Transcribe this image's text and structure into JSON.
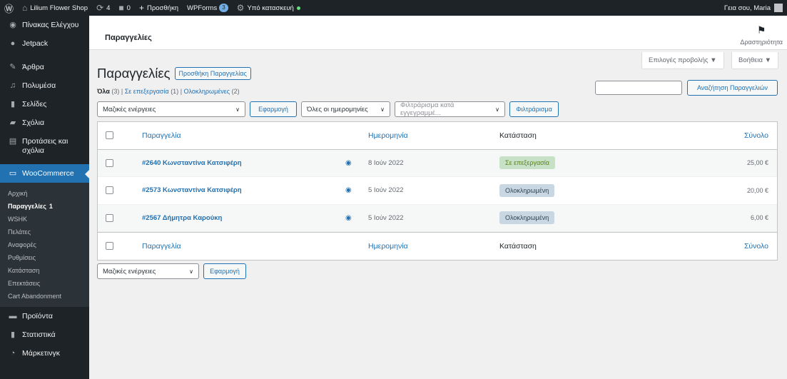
{
  "adminbar": {
    "site_name": "Lilium Flower Shop",
    "updates_count": "4",
    "comments_count": "0",
    "new_label": "Προσθήκη",
    "wpforms_label": "WPForms",
    "wpforms_count": "3",
    "maintenance_label": "Υπό κατασκευή",
    "greeting": "Γεια σου, Maria"
  },
  "sidebar": {
    "items_top": [
      {
        "label": "Πίνακας Ελέγχου",
        "icon": "dashboard-icon"
      },
      {
        "label": "Jetpack",
        "icon": "jetpack-icon"
      },
      {
        "label": "Άρθρα",
        "icon": "pin-icon"
      },
      {
        "label": "Πολυμέσα",
        "icon": "media-icon"
      },
      {
        "label": "Σελίδες",
        "icon": "page-icon"
      },
      {
        "label": "Σχόλια",
        "icon": "comment-icon"
      },
      {
        "label": "Προτάσεις και σχόλια",
        "icon": "feedback-icon"
      }
    ],
    "woocommerce_label": "WooCommerce",
    "sub_items": [
      "Αρχική",
      "Παραγγελίες",
      "WSHK",
      "Πελάτες",
      "Αναφορές",
      "Ρυθμίσεις",
      "Κατάσταση",
      "Επεκτάσεις",
      "Cart Abandonment"
    ],
    "orders_count": "1",
    "items_bottom": [
      {
        "label": "Προϊόντα",
        "icon": "products-icon"
      },
      {
        "label": "Στατιστικά",
        "icon": "stats-icon"
      },
      {
        "label": "Μάρκετινγκ",
        "icon": "marketing-icon"
      }
    ]
  },
  "header": {
    "title": "Παραγγελίες",
    "activity_label": "Δραστηριότητα"
  },
  "screen_options_label": "Επιλογές προβολής ▼",
  "help_label": "Βοήθεια ▼",
  "page": {
    "title": "Παραγγελίες",
    "add_button": "Προσθήκη Παραγγελίας"
  },
  "filters": {
    "all": "Όλα",
    "all_count": "(3)",
    "processing": "Σε επεξεργασία",
    "processing_count": "(1)",
    "completed": "Ολοκληρωμένες",
    "completed_count": "(2)"
  },
  "search": {
    "button_label": "Αναζήτηση Παραγγελιών",
    "value": ""
  },
  "tablenav": {
    "bulk_actions": "Μαζικές ενέργειες",
    "apply": "Εφαρμογή",
    "all_dates": "Όλες οι ημερομηνίες",
    "customer_placeholder": "Φιλτράρισμα κατά εγγεγραμμέ...",
    "filter_button": "Φιλτράρισμα"
  },
  "table": {
    "headers": {
      "order": "Παραγγελία",
      "date": "Ημερομηνία",
      "status": "Κατάσταση",
      "total": "Σύνολο"
    },
    "rows": [
      {
        "order": "#2640 Κωνσταντίνα Κατσιφέρη",
        "date": "8 Ιούν 2022",
        "status": "Σε επεξεργασία",
        "status_type": "processing",
        "total": "25,00 €"
      },
      {
        "order": "#2573 Κωνσταντίνα Κατσιφέρη",
        "date": "5 Ιούν 2022",
        "status": "Ολοκληρωμένη",
        "status_type": "completed",
        "total": "20,00 €"
      },
      {
        "order": "#2567 Δήμητρα Καρούκη",
        "date": "5 Ιούν 2022",
        "status": "Ολοκληρωμένη",
        "status_type": "completed",
        "total": "6,00 €"
      }
    ]
  },
  "colors": {
    "admin_dark": "#1d2327",
    "accent_blue": "#2271b1",
    "processing_bg": "#c6e1c6",
    "completed_bg": "#c8d7e1"
  }
}
